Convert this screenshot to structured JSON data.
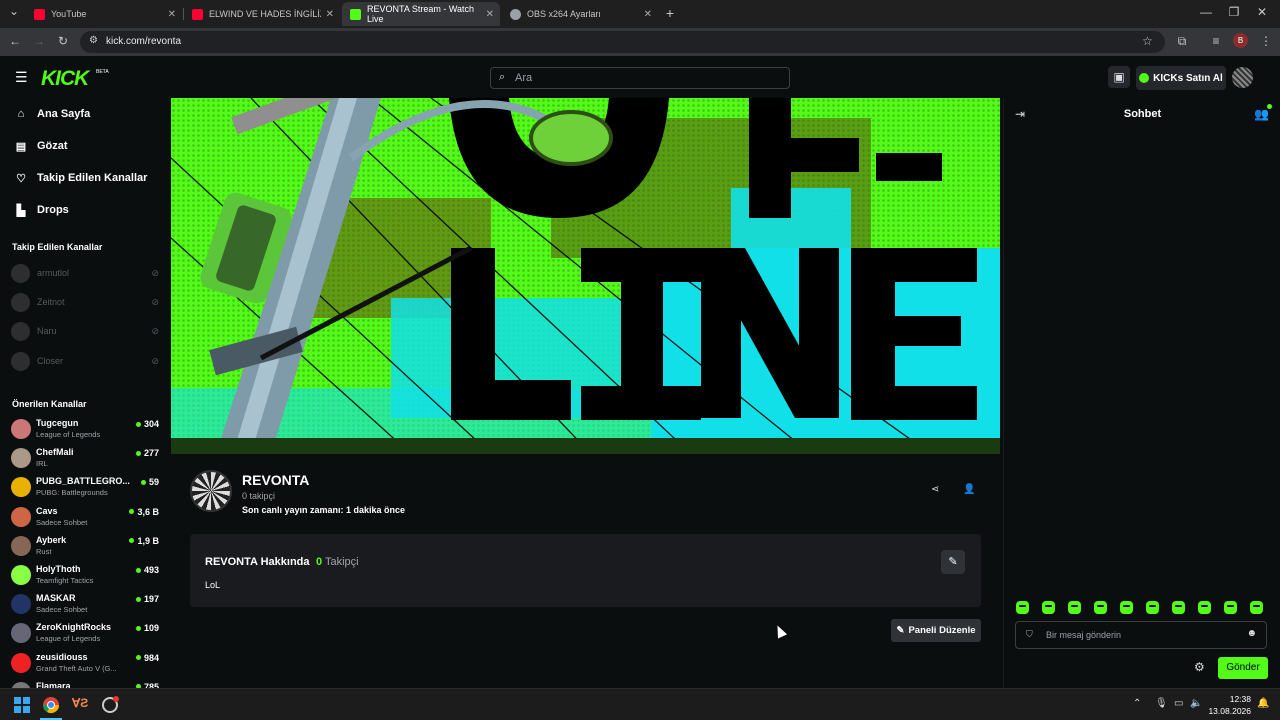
{
  "browser": {
    "tabs": [
      {
        "label": "YouTube",
        "color": "#ff0033"
      },
      {
        "label": "ELWIND VE HADES İNGİLİZ KIZL",
        "color": "#ff0033"
      },
      {
        "label": "REVONTA Stream - Watch Live",
        "color": "#53fc18"
      },
      {
        "label": "OBS x264 Ayarları",
        "color": "#9aa0a6"
      }
    ],
    "url": "kick.com/revonta",
    "profile_letter": "B"
  },
  "header": {
    "logo": "KICK",
    "beta": "BETA",
    "search_placeholder": "Ara",
    "kicks_button": "KICKs Satın Al"
  },
  "sidebar": {
    "nav": [
      {
        "label": "Ana Sayfa",
        "icon": "home-icon"
      },
      {
        "label": "Gözat",
        "icon": "browse-icon"
      },
      {
        "label": "Takip Edilen Kanallar",
        "icon": "heart-icon"
      },
      {
        "label": "Drops",
        "icon": "drops-icon"
      }
    ],
    "followed_title": "Takip Edilen Kanallar",
    "followed": [
      {
        "name": "armutlol"
      },
      {
        "name": "Zeitnot"
      },
      {
        "name": "Naru"
      },
      {
        "name": "Closer"
      }
    ],
    "recommended_title": "Önerilen Kanallar",
    "recommended": [
      {
        "name": "Tugcegun",
        "category": "League of Legends",
        "viewers": "304",
        "color": "#c77"
      },
      {
        "name": "ChefMali",
        "category": "IRL",
        "viewers": "277",
        "color": "#a98"
      },
      {
        "name": "PUBG_BATTLEGRO...",
        "category": "PUBG: Battlegrounds",
        "viewers": "59",
        "color": "#e8b100"
      },
      {
        "name": "Cavs",
        "category": "Sadece Sohbet",
        "viewers": "3,6 B",
        "color": "#c64"
      },
      {
        "name": "Ayberk",
        "category": "Rust",
        "viewers": "1,9 B",
        "color": "#865"
      },
      {
        "name": "HolyThoth",
        "category": "Teamfight Tactics",
        "viewers": "493",
        "color": "#8f4"
      },
      {
        "name": "MASKAR",
        "category": "Sadece Sohbet",
        "viewers": "197",
        "color": "#236"
      },
      {
        "name": "ZeroKnightRocks",
        "category": "League of Legends",
        "viewers": "109",
        "color": "#667"
      },
      {
        "name": "zeusidiouss",
        "category": "Grand Theft Auto V (G...",
        "viewers": "984",
        "color": "#e22"
      },
      {
        "name": "Flamara",
        "category": "",
        "viewers": "785",
        "color": "#777"
      }
    ]
  },
  "banner": {
    "line1": "OFF-",
    "line2": "LINE"
  },
  "channel": {
    "name": "REVONTA",
    "followers": "0 takipçi",
    "last_live": "Son canlı yayın zamanı: 1 dakika önce",
    "about_title": "REVONTA Hakkında",
    "about_count": "0",
    "about_count_label": "Takipçi",
    "about_text": "LoL",
    "panel_button": "Paneli Düzenle"
  },
  "chat": {
    "title": "Sohbet",
    "placeholder": "Bir mesaj gönderin",
    "send": "Gönder"
  },
  "taskbar": {
    "time": "12:38",
    "date": "13.08.2026"
  }
}
